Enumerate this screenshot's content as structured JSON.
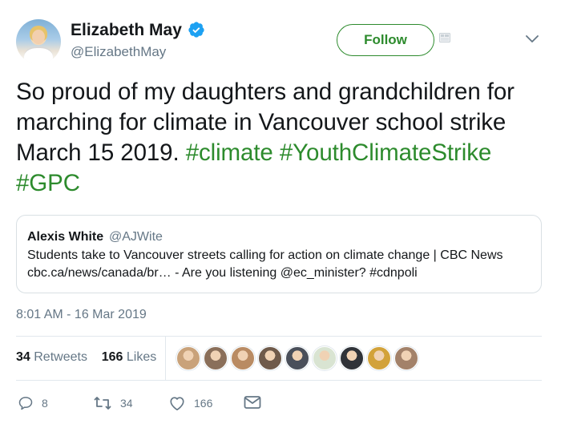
{
  "author": {
    "name": "Elizabeth May",
    "handle": "@ElizabethMay",
    "verified": true
  },
  "header": {
    "follow_label": "Follow"
  },
  "tweet": {
    "text_plain": "So proud of my daughters and grandchildren for marching for climate in Vancouver school strike March 15 2019. ",
    "hashtags": [
      "#climate",
      "#YouthClimateStrike",
      "#GPC"
    ],
    "hashtag_sep": " "
  },
  "quote": {
    "name": "Alexis White",
    "handle": "@AJWite",
    "line1": "Students take to Vancouver streets calling for action on climate change | CBC News",
    "line2": "cbc.ca/news/canada/br… - Are you listening @ec_minister? #cdnpoli"
  },
  "timestamp": "8:01 AM - 16 Mar 2019",
  "stats": {
    "retweets_count": "34",
    "retweets_label": "Retweets",
    "likes_count": "166",
    "likes_label": "Likes"
  },
  "liker_avatars": [
    {
      "color": "#c9a27a"
    },
    {
      "color": "#8a6f5a"
    },
    {
      "color": "#b98b63"
    },
    {
      "color": "#6f5a4a"
    },
    {
      "color": "#4a4f5a"
    },
    {
      "color": "#d9e4d2"
    },
    {
      "color": "#2f3238"
    },
    {
      "color": "#d2a23a"
    },
    {
      "color": "#a3826a"
    }
  ],
  "actions": {
    "reply_count": "8",
    "retweet_count": "34",
    "like_count": "166"
  },
  "colors": {
    "accent_green": "#2d8b2d",
    "verified_blue": "#1da1f2",
    "muted": "#657786",
    "border": "#e1e8ed"
  }
}
